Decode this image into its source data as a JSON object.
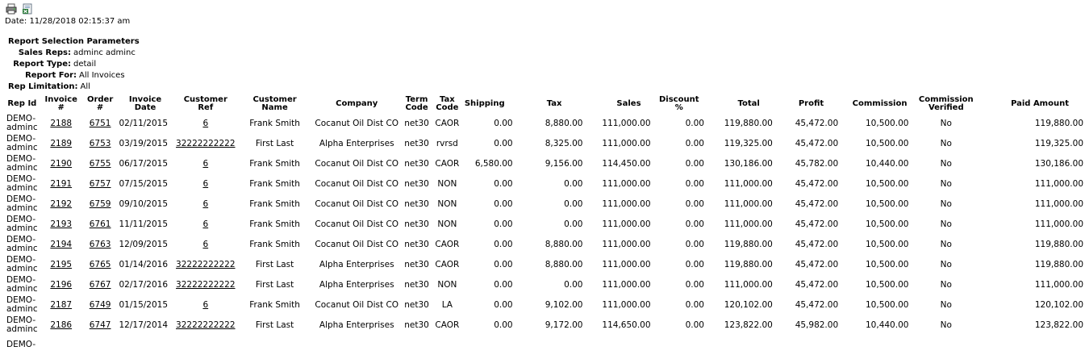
{
  "toolbar": {
    "print_icon": "printer-icon",
    "export_icon": "excel-export-icon"
  },
  "date_line": "Date: 11/28/2018 02:15:37 am",
  "params": {
    "title": "Report Selection Parameters",
    "rows": [
      {
        "label": "Sales Reps:",
        "value": "adminc adminc"
      },
      {
        "label": "Report Type:",
        "value": "detail"
      },
      {
        "label": "Report For:",
        "value": "All Invoices"
      },
      {
        "label": "Rep Limitation:",
        "value": "All"
      }
    ]
  },
  "table": {
    "headers": {
      "rep_id": "Rep Id",
      "invoice": "Invoice #",
      "order": "Order #",
      "invoice_date": "Invoice Date",
      "customer_ref": "Customer Ref",
      "customer_name": "Customer Name",
      "company": "Company",
      "term_code_1": "Term",
      "term_code_2": "Code",
      "tax_code_1": "Tax",
      "tax_code_2": "Code",
      "shipping": "Shipping",
      "tax": "Tax",
      "sales": "Sales",
      "discount": "Discount %",
      "total": "Total",
      "profit": "Profit",
      "commission": "Commission",
      "comm_verified_1": "Commission",
      "comm_verified_2": "Verified",
      "paid_amount": "Paid Amount"
    },
    "rows": [
      {
        "rep1": "DEMO-",
        "rep2": "adminc",
        "invoice": "2188",
        "order": "6751",
        "date": "02/11/2015",
        "ref": "6",
        "name": "Frank Smith",
        "company": "Cocanut Oil Dist CO",
        "term": "net30",
        "taxcode": "CAOR",
        "shipping": "0.00",
        "tax": "8,880.00",
        "sales": "111,000.00",
        "discount": "0.00",
        "total": "119,880.00",
        "profit": "45,472.00",
        "commission": "10,500.00",
        "verified": "No",
        "paid": "119,880.00"
      },
      {
        "rep1": "DEMO-",
        "rep2": "adminc",
        "invoice": "2189",
        "order": "6753",
        "date": "03/19/2015",
        "ref": "32222222222",
        "name": "First Last",
        "company": "Alpha Enterprises",
        "term": "net30",
        "taxcode": "rvrsd",
        "shipping": "0.00",
        "tax": "8,325.00",
        "sales": "111,000.00",
        "discount": "0.00",
        "total": "119,325.00",
        "profit": "45,472.00",
        "commission": "10,500.00",
        "verified": "No",
        "paid": "119,325.00"
      },
      {
        "rep1": "DEMO-",
        "rep2": "adminc",
        "invoice": "2190",
        "order": "6755",
        "date": "06/17/2015",
        "ref": "6",
        "name": "Frank Smith",
        "company": "Cocanut Oil Dist CO",
        "term": "net30",
        "taxcode": "CAOR",
        "shipping": "6,580.00",
        "tax": "9,156.00",
        "sales": "114,450.00",
        "discount": "0.00",
        "total": "130,186.00",
        "profit": "45,782.00",
        "commission": "10,440.00",
        "verified": "No",
        "paid": "130,186.00"
      },
      {
        "rep1": "DEMO-",
        "rep2": "adminc",
        "invoice": "2191",
        "order": "6757",
        "date": "07/15/2015",
        "ref": "6",
        "name": "Frank Smith",
        "company": "Cocanut Oil Dist CO",
        "term": "net30",
        "taxcode": "NON",
        "shipping": "0.00",
        "tax": "0.00",
        "sales": "111,000.00",
        "discount": "0.00",
        "total": "111,000.00",
        "profit": "45,472.00",
        "commission": "10,500.00",
        "verified": "No",
        "paid": "111,000.00"
      },
      {
        "rep1": "DEMO-",
        "rep2": "adminc",
        "invoice": "2192",
        "order": "6759",
        "date": "09/10/2015",
        "ref": "6",
        "name": "Frank Smith",
        "company": "Cocanut Oil Dist CO",
        "term": "net30",
        "taxcode": "NON",
        "shipping": "0.00",
        "tax": "0.00",
        "sales": "111,000.00",
        "discount": "0.00",
        "total": "111,000.00",
        "profit": "45,472.00",
        "commission": "10,500.00",
        "verified": "No",
        "paid": "111,000.00"
      },
      {
        "rep1": "DEMO-",
        "rep2": "adminc",
        "invoice": "2193",
        "order": "6761",
        "date": "11/11/2015",
        "ref": "6",
        "name": "Frank Smith",
        "company": "Cocanut Oil Dist CO",
        "term": "net30",
        "taxcode": "NON",
        "shipping": "0.00",
        "tax": "0.00",
        "sales": "111,000.00",
        "discount": "0.00",
        "total": "111,000.00",
        "profit": "45,472.00",
        "commission": "10,500.00",
        "verified": "No",
        "paid": "111,000.00"
      },
      {
        "rep1": "DEMO-",
        "rep2": "adminc",
        "invoice": "2194",
        "order": "6763",
        "date": "12/09/2015",
        "ref": "6",
        "name": "Frank Smith",
        "company": "Cocanut Oil Dist CO",
        "term": "net30",
        "taxcode": "CAOR",
        "shipping": "0.00",
        "tax": "8,880.00",
        "sales": "111,000.00",
        "discount": "0.00",
        "total": "119,880.00",
        "profit": "45,472.00",
        "commission": "10,500.00",
        "verified": "No",
        "paid": "119,880.00"
      },
      {
        "rep1": "DEMO-",
        "rep2": "adminc",
        "invoice": "2195",
        "order": "6765",
        "date": "01/14/2016",
        "ref": "32222222222",
        "name": "First Last",
        "company": "Alpha Enterprises",
        "term": "net30",
        "taxcode": "CAOR",
        "shipping": "0.00",
        "tax": "8,880.00",
        "sales": "111,000.00",
        "discount": "0.00",
        "total": "119,880.00",
        "profit": "45,472.00",
        "commission": "10,500.00",
        "verified": "No",
        "paid": "119,880.00"
      },
      {
        "rep1": "DEMO-",
        "rep2": "adminc",
        "invoice": "2196",
        "order": "6767",
        "date": "02/17/2016",
        "ref": "32222222222",
        "name": "First Last",
        "company": "Alpha Enterprises",
        "term": "net30",
        "taxcode": "NON",
        "shipping": "0.00",
        "tax": "0.00",
        "sales": "111,000.00",
        "discount": "0.00",
        "total": "111,000.00",
        "profit": "45,472.00",
        "commission": "10,500.00",
        "verified": "No",
        "paid": "111,000.00"
      },
      {
        "rep1": "DEMO-",
        "rep2": "adminc",
        "invoice": "2187",
        "order": "6749",
        "date": "01/15/2015",
        "ref": "6",
        "name": "Frank Smith",
        "company": "Cocanut Oil Dist CO",
        "term": "net30",
        "taxcode": "LA",
        "shipping": "0.00",
        "tax": "9,102.00",
        "sales": "111,000.00",
        "discount": "0.00",
        "total": "120,102.00",
        "profit": "45,472.00",
        "commission": "10,500.00",
        "verified": "No",
        "paid": "120,102.00"
      },
      {
        "rep1": "DEMO-",
        "rep2": "adminc",
        "invoice": "2186",
        "order": "6747",
        "date": "12/17/2014",
        "ref": "32222222222",
        "name": "First Last",
        "company": "Alpha Enterprises",
        "term": "net30",
        "taxcode": "CAOR",
        "shipping": "0.00",
        "tax": "9,172.00",
        "sales": "114,650.00",
        "discount": "0.00",
        "total": "123,822.00",
        "profit": "45,982.00",
        "commission": "10,440.00",
        "verified": "No",
        "paid": "123,822.00"
      },
      {
        "rep1": "DEMO-",
        "rep2": "",
        "invoice": "",
        "order": "",
        "date": "",
        "ref": "",
        "name": "",
        "company": "",
        "term": "",
        "taxcode": "",
        "shipping": "",
        "tax": "",
        "sales": "",
        "discount": "",
        "total": "",
        "profit": "",
        "commission": "",
        "verified": "",
        "paid": ""
      }
    ]
  }
}
